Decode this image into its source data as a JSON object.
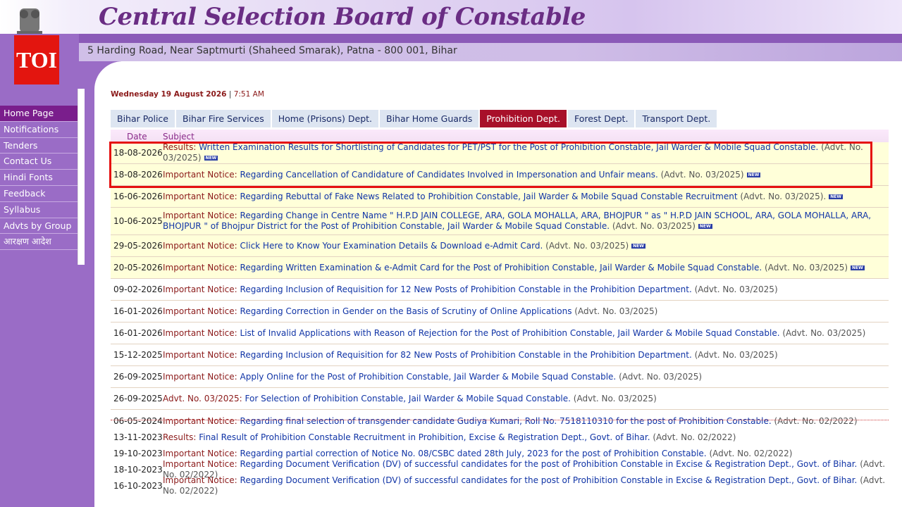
{
  "header": {
    "title": "Central Selection Board of Constable",
    "address": "5 Harding Road, Near Saptmurti (Shaheed Smarak), Patna - 800 001, Bihar",
    "toi": "TOI"
  },
  "datetime": {
    "date": "Wednesday 19 August 2026",
    "sep": "|",
    "time": "7:51 AM"
  },
  "nav": [
    "Home Page",
    "Notifications",
    "Tenders",
    "Contact Us",
    "Hindi Fonts",
    "Feedback",
    "Syllabus",
    "Advts by Group",
    "आरक्षण आदेश"
  ],
  "tabs": [
    "Bihar Police",
    "Bihar Fire Services",
    "Home (Prisons) Dept.",
    "Bihar Home Guards",
    "Prohibition Dept.",
    "Forest Dept.",
    "Transport Dept."
  ],
  "table_header": {
    "date": "Date",
    "subject": "Subject"
  },
  "new_badge": "NEW",
  "rows": [
    {
      "date": "18-08-2026",
      "label": "Results:",
      "text": "Written Examination Results for Shortlisting of Candidates for PET/PST for the Post of Prohibition Constable, Jail Warder & Mobile Squad Constable.",
      "adv": "(Advt. No. 03/2025)",
      "new": true
    },
    {
      "date": "18-08-2026",
      "label": "Important Notice:",
      "text": "Regarding Cancellation of Candidature of Candidates Involved in Impersonation and Unfair means.",
      "adv": "(Advt. No. 03/2025)",
      "new": true
    },
    {
      "date": "16-06-2026",
      "label": "Important Notice:",
      "text": "Regarding Rebuttal of Fake News Related to Prohibition Constable, Jail Warder & Mobile Squad Constable Recruitment",
      "adv": "(Advt. No. 03/2025).",
      "new": true
    },
    {
      "date": "10-06-2025",
      "label": "Important Notice:",
      "text": "Regarding Change in Centre Name \" H.P.D JAIN COLLEGE, ARA, GOLA MOHALLA, ARA, BHOJPUR \" as \" H.P.D JAIN SCHOOL, ARA, GOLA MOHALLA, ARA, BHOJPUR \" of Bhojpur District for the Post of Prohibition Constable, Jail Warder & Mobile Squad Constable.",
      "adv": "(Advt. No. 03/2025)",
      "new": true
    },
    {
      "date": "29-05-2026",
      "label": "Important Notice:",
      "text": "Click Here to Know Your Examination Details & Download e-Admit Card.",
      "adv": "(Advt. No. 03/2025)",
      "new": true
    },
    {
      "date": "20-05-2026",
      "label": "Important Notice:",
      "text": "Regarding Written Examination & e-Admit Card for the Post of Prohibition Constable, Jail Warder & Mobile Squad Constable.",
      "adv": "(Advt. No. 03/2025)",
      "new": true
    },
    {
      "date": "09-02-2026",
      "label": "Important Notice:",
      "text": "Regarding Inclusion of Requisition for 12 New Posts of Prohibition Constable in the Prohibition Department.",
      "adv": "(Advt. No. 03/2025)",
      "new": false
    },
    {
      "date": "16-01-2026",
      "label": "Important Notice:",
      "text": "Regarding Correction in Gender on the Basis of Scrutiny of Online Applications",
      "adv": "(Advt. No. 03/2025)",
      "new": false
    },
    {
      "date": "16-01-2026",
      "label": "Important Notice:",
      "text": "List of Invalid Applications with Reason of Rejection for the Post of Prohibition Constable, Jail Warder & Mobile Squad Constable.",
      "adv": "(Advt. No. 03/2025)",
      "new": false
    },
    {
      "date": "15-12-2025",
      "label": "Important Notice:",
      "text": "Regarding Inclusion of Requisition for 82 New Posts of Prohibition Constable in the Prohibition Department.",
      "adv": "(Advt. No. 03/2025)",
      "new": false
    },
    {
      "date": "26-09-2025",
      "label": "Important Notice:",
      "text": "Apply Online for the Post of Prohibition Constable, Jail Warder & Mobile Squad Constable.",
      "adv": "(Advt. No. 03/2025)",
      "new": false
    },
    {
      "date": "26-09-2025",
      "label": "Advt. No. 03/2025:",
      "text": "For Selection of Prohibition Constable, Jail Warder & Mobile Squad Constable.",
      "adv": "(Advt. No. 03/2025)",
      "new": false
    },
    {
      "date": "06-05-2024",
      "label": "Important Notice:",
      "text": "Regarding final selection of transgender candidate Gudiya Kumari, Roll No. 7518110310 for the post of Prohibition Constable.",
      "adv": "(Advt. No. 02/2022)",
      "new": false
    },
    {
      "date": "13-11-2023",
      "label": "Results:",
      "text": "Final Result of Prohibition Constable Recruitment in Prohibition, Excise & Registration Dept., Govt. of Bihar.",
      "adv": "(Advt. No. 02/2022)",
      "new": false
    },
    {
      "date": "19-10-2023",
      "label": "Important Notice:",
      "text": "Regarding partial correction of Notice No. 08/CSBC dated 28th July, 2023 for the post of Prohibition Constable.",
      "adv": "(Advt. No. 02/2022)",
      "new": false
    },
    {
      "date": "18-10-2023",
      "label": "Important Notice:",
      "text": "Regarding Document Verification (DV) of successful candidates for the post of Prohibition Constable in Excise & Registration Dept., Govt. of Bihar.",
      "adv": "(Advt. No. 02/2022)",
      "new": false
    },
    {
      "date": "16-10-2023",
      "label": "Important Notice:",
      "text": "Regarding Document Verification (DV) of successful candidates for the post of Prohibition Constable in Excise & Registration Dept., Govt. of Bihar.",
      "adv": "(Advt. No. 02/2022)",
      "new": false
    }
  ]
}
